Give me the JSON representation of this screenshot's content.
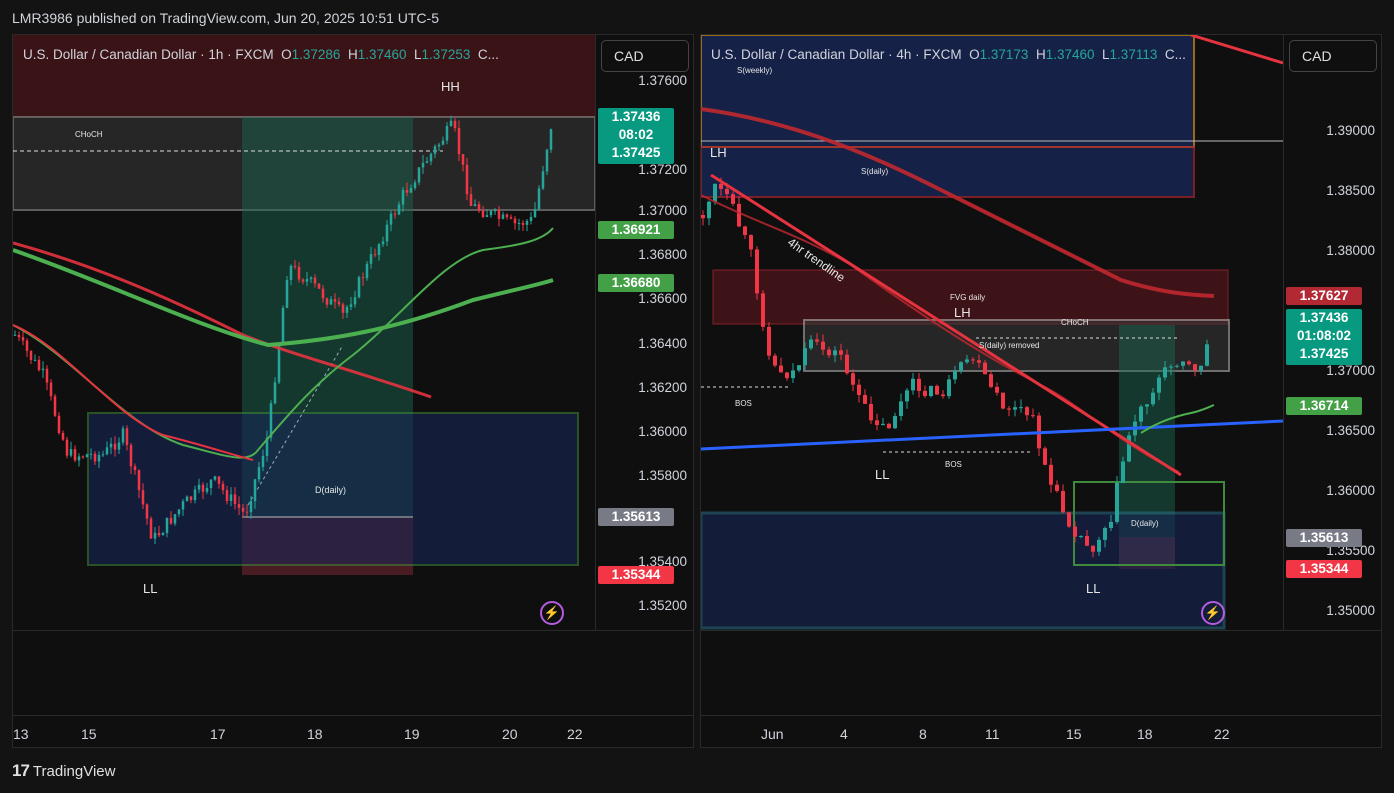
{
  "publish_line": "LMR3986 published on TradingView.com, Jun 20, 2025 10:51 UTC-5",
  "footer_brand": "TradingView",
  "left_chart": {
    "legend_title": "U.S. Dollar / Canadian Dollar · 1h · FXCM",
    "ohlc": {
      "o_label": "O",
      "o": "1.37286",
      "h_label": "H",
      "h": "1.37460",
      "l_label": "L",
      "l": "1.37253",
      "c_label": "C..."
    },
    "currency": "CAD",
    "y_ticks": [
      "1.37600",
      "1.37200",
      "1.37000",
      "1.36800",
      "1.36600",
      "1.36400",
      "1.36200",
      "1.36000",
      "1.35800",
      "1.35400",
      "1.35200"
    ],
    "price_tags": {
      "last": "1.37436",
      "countdown": "08:02",
      "bid": "1.37425",
      "ma_fast": "1.36921",
      "ma_slow": "1.36680",
      "target": "1.35613",
      "stop": "1.35344"
    },
    "x_ticks": [
      "13",
      "15",
      "17",
      "18",
      "19",
      "20",
      "22"
    ],
    "annotations": {
      "hh": "HH",
      "choch": "CHoCH",
      "ll": "LL",
      "demand": "D(daily)"
    }
  },
  "right_chart": {
    "legend_title": "U.S. Dollar / Canadian Dollar · 4h · FXCM",
    "ohlc": {
      "o_label": "O",
      "o": "1.37173",
      "h_label": "H",
      "h": "1.37460",
      "l_label": "L",
      "l": "1.37113",
      "c_label": "C..."
    },
    "currency": "CAD",
    "y_ticks": [
      "1.39000",
      "1.38500",
      "1.38000",
      "1.37000",
      "1.36500",
      "1.36000",
      "1.35500",
      "1.35000"
    ],
    "price_tags": {
      "ma_red": "1.37627",
      "last": "1.37436",
      "countdown": "01:08:02",
      "bid": "1.37425",
      "ma_green": "1.36714",
      "target": "1.35613",
      "stop": "1.35344"
    },
    "x_ticks": [
      "Jun",
      "4",
      "8",
      "11",
      "15",
      "18",
      "22"
    ],
    "annotations": {
      "s_weekly": "S(weekly)",
      "lh1": "LH",
      "s_daily": "S(daily)",
      "trendline": "4hr trendline",
      "fvg": "FVG daily",
      "lh2": "LH",
      "choch": "CHoCH",
      "s_removed": "S(daily) removed",
      "bos1": "BOS",
      "bos2": "BOS",
      "ll1": "LL",
      "ll2": "LL",
      "demand": "D(daily)"
    }
  },
  "colors": {
    "up": "#26a69a",
    "down": "#f23645",
    "ma_red": "#e5333f",
    "ma_green": "#4caf50",
    "trend_blue": "#2962ff",
    "bg": "#0f0f0f"
  }
}
